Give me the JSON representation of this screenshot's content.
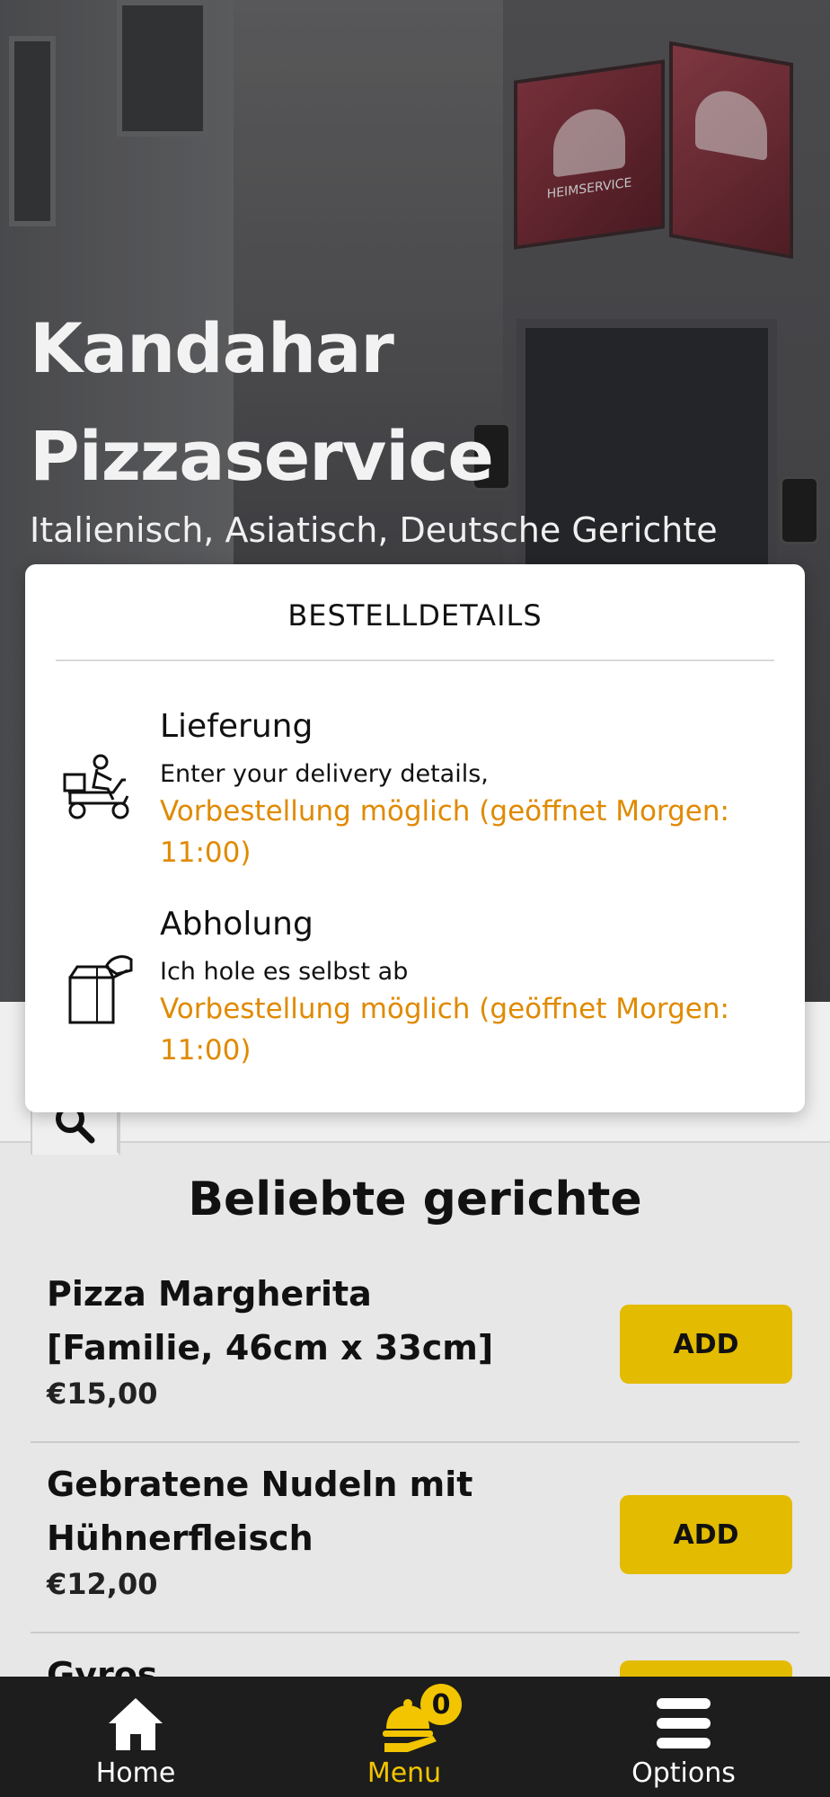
{
  "hero": {
    "title_line1": "Kandahar",
    "title_line2": "Pizzaservice",
    "subtitle": "Italienisch, Asiatisch, Deutsche Gerichte",
    "sign_text": "HEIMSERVICE"
  },
  "modal": {
    "title": "BESTELLDETAILS",
    "options": [
      {
        "icon": "delivery-scooter-icon",
        "title": "Lieferung",
        "description": "Enter your delivery details,",
        "note": "Vorbestellung möglich (geöffnet Morgen: 11:00)"
      },
      {
        "icon": "pickup-bag-icon",
        "title": "Abholung",
        "description": "Ich hole es selbst ab",
        "note": "Vorbestellung möglich (geöffnet Morgen: 11:00)"
      }
    ]
  },
  "search": {
    "icon": "search-icon"
  },
  "popular": {
    "title": "Beliebte gerichte",
    "items": [
      {
        "name": "Pizza Margherita [Familie, 46cm x 33cm]",
        "price": "€15,00",
        "button": "ADD"
      },
      {
        "name": "Gebratene Nudeln mit Hühnerfleisch",
        "price": "€12,00",
        "button": "ADD"
      },
      {
        "name": "Gyros",
        "price": "",
        "button": "ADD"
      }
    ]
  },
  "bottom_nav": {
    "items": [
      {
        "label": "Home",
        "icon": "home-icon",
        "active": false
      },
      {
        "label": "Menu",
        "icon": "cloche-icon",
        "active": true,
        "badge": "0"
      },
      {
        "label": "Options",
        "icon": "hamburger-menu-icon",
        "active": false
      }
    ]
  },
  "colors": {
    "accent": "#e3bb00",
    "note": "#e08a00",
    "nav_bg": "#1d1d1d",
    "active_nav": "#f2c500"
  }
}
